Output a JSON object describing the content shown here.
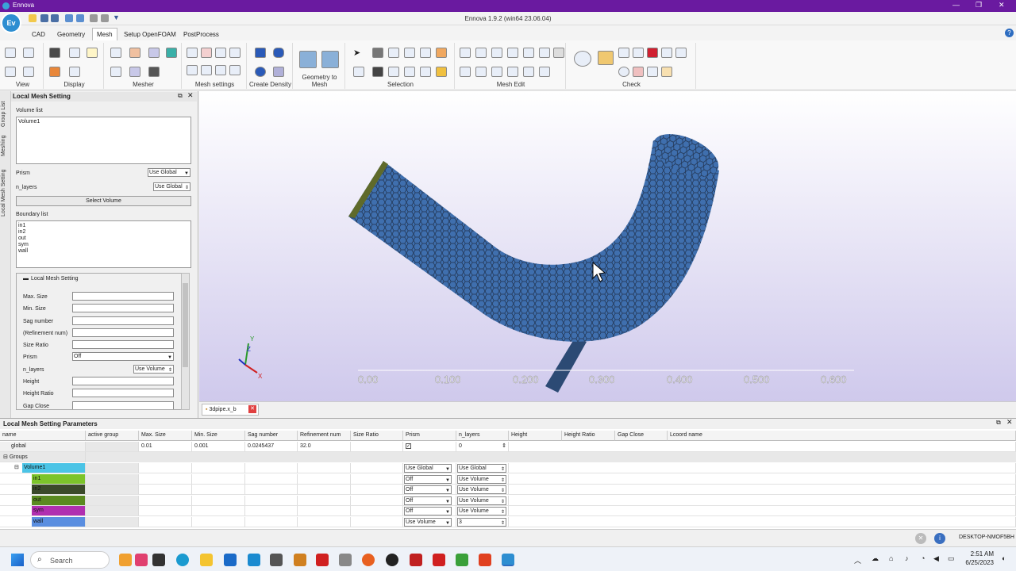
{
  "window": {
    "app_name": "Ennova",
    "title": "Ennova 1.9.2 (win64 23.06.04)"
  },
  "menu_tabs": [
    "CAD",
    "Geometry",
    "Mesh",
    "Setup OpenFOAM",
    "PostProcess"
  ],
  "active_tab": "Mesh",
  "ribbon_groups": [
    "View",
    "Display",
    "Mesher",
    "Mesh settings",
    "Create Density",
    "Geometry to Mesh",
    "Selection",
    "Mesh Edit",
    "Check"
  ],
  "side_tabs": [
    "Group List",
    "Meshing",
    "Local Mesh Setting"
  ],
  "left_panel": {
    "title": "Local Mesh Setting",
    "volume_list_label": "Volume list",
    "volume_items": [
      "Volume1"
    ],
    "prism_label": "Prism",
    "prism_value": "Use Global",
    "n_layers_label": "n_layers",
    "n_layers_value": "Use Global",
    "select_volume_button": "Select Volume",
    "boundary_list_label": "Boundary list",
    "boundary_items": [
      "in1",
      "in2",
      "out",
      "sym",
      "wall"
    ],
    "section_title": "Local Mesh Setting",
    "fields": [
      "Max. Size",
      "Min. Size",
      "Sag number",
      "(Refinement num)",
      "Size Ratio"
    ],
    "prism2_label": "Prism",
    "prism2_value": "Off",
    "n_layers2_label": "n_layers",
    "n_layers2_value": "Use Volume",
    "fields2": [
      "Height",
      "Height Ratio",
      "Gap Close"
    ]
  },
  "viewport": {
    "axis_labels": [
      "0.00",
      "0.100",
      "0.200",
      "0.300",
      "0.400",
      "0.500",
      "0.600"
    ],
    "triad": {
      "x": "X",
      "y": "Y",
      "z": "Z"
    },
    "mesh_color": "#3f6fae",
    "doc_tab": "3dpipe.x_b"
  },
  "params_table": {
    "title": "Local Mesh Setting Parameters",
    "columns": [
      "name",
      "active group",
      "Max. Size",
      "Min. Size",
      "Sag number",
      "Refinement num",
      "Size Ratio",
      "Prism",
      "n_layers",
      "Height",
      "Height Ratio",
      "Gap Close",
      "Lcoord name"
    ],
    "global_row": {
      "name": "global",
      "max": "0.01",
      "min": "0.001",
      "sag": "0.0245437",
      "ref": "32.0",
      "prism": "",
      "n_layers": "0"
    },
    "groups_label": "Groups",
    "rows": [
      {
        "name": "Volume1",
        "color": "#4bc4e6",
        "prism": "Use Global",
        "n_layers": "Use Global"
      },
      {
        "name": "in1",
        "color": "#7cc42a",
        "prism": "Off",
        "n_layers": "Use Volume"
      },
      {
        "name": "in2",
        "color": "#3b4a2a",
        "prism": "Off",
        "n_layers": "Use Volume"
      },
      {
        "name": "out",
        "color": "#5a8a20",
        "prism": "Off",
        "n_layers": "Use Volume"
      },
      {
        "name": "sym",
        "color": "#b02fb0",
        "prism": "Off",
        "n_layers": "Use Volume"
      },
      {
        "name": "wall",
        "color": "#5a8ee0",
        "prism": "Use Volume",
        "n_layers": "3"
      }
    ]
  },
  "statusbar": {
    "computer": "DESKTOP-NMOF5BH"
  },
  "taskbar": {
    "search": "Search",
    "time": "2:51 AM",
    "date": "6/25/2023"
  }
}
